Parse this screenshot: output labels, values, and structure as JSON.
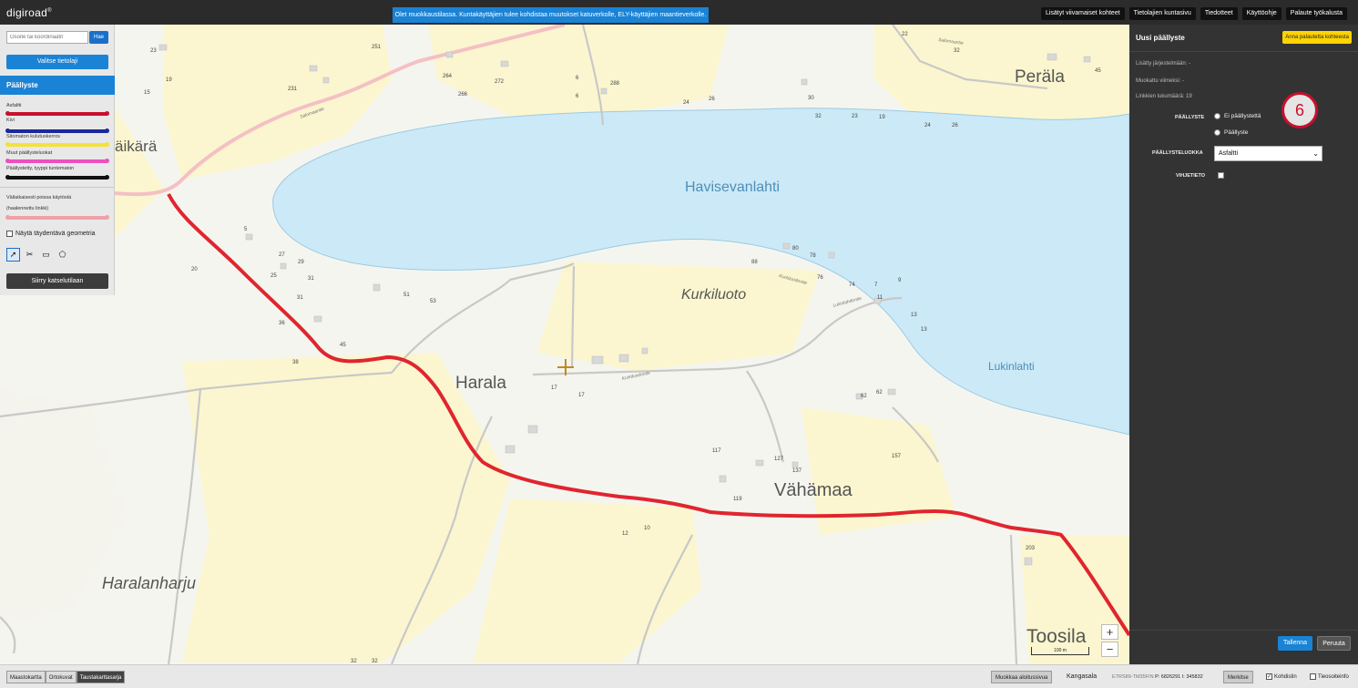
{
  "app": {
    "logo": "digiroad",
    "logo_mark": "®"
  },
  "notice": "Olet muokkaustilassa. Kuntakäyttäjien tulee kohdistaa muutokset katuverkolle, ELY-käyttäjien maantieverkolle.",
  "topnav": [
    "Lisätyt viivamaiset kohteet",
    "Tietolajien kuntasivu",
    "Tiedotteet",
    "Käyttöohje",
    "Palaute työkalusta"
  ],
  "left_panel": {
    "search_placeholder": "Osoite tai koordinaatit",
    "search_button": "Hae",
    "select_layer_button": "Valitse tietolaji",
    "layer_title": "Päällyste",
    "legend": [
      {
        "label": "Asfaltti",
        "color": "#c8102e"
      },
      {
        "label": "Kivi",
        "color": "#1a2a9a"
      },
      {
        "label": "Sitomaton kulutuskerros",
        "color": "#f3e23a"
      },
      {
        "label": "Muut päällysteluokat",
        "color": "#ee4fc0"
      },
      {
        "label": "Päällystetty, tyyppi tuntematon",
        "color": "#111111"
      }
    ],
    "temp_label_1": "Väliaikaisesti poissa käytöstä",
    "temp_label_2": "(haalennettu linkki)",
    "temp_color": "#f0a0a8",
    "show_geometry": "Näytä täydentävä geometria",
    "tools": [
      "select-tool",
      "cut-tool",
      "rectangle-tool",
      "polygon-tool"
    ],
    "view_mode_button": "Siirry katselutilaan"
  },
  "right_panel": {
    "title": "Uusi päällyste",
    "feedback_button": "Anna palautetta kohteesta",
    "added_to_system": "Lisätty järjestelmään: -",
    "modified_last": "Muokattu viimeksi: -",
    "link_count": "Linkkien lukumäärä: 19",
    "surface_label": "PÄÄLLYSTE",
    "option_none": "Ei päällystettä",
    "option_surface": "Päällyste",
    "class_label": "PÄÄLLYSTELUOKKA",
    "class_value": "Asfaltti",
    "hint_label": "VIHJETIETO",
    "marker": "6",
    "save_button": "Tallenna",
    "cancel_button": "Peruuta"
  },
  "bottom_bar": {
    "basemaps": [
      "Maastokartta",
      "Ortokuvat",
      "Taustakarttasarja"
    ],
    "active_basemap": "Taustakarttasarja",
    "start_page_button": "Muokkaa aloitussivua",
    "municipality": "Kangasala",
    "crs": "ETRS89-TM35FIN",
    "p_coord": "P: 6826291",
    "i_coord": "I: 345832",
    "mark_button": "Merkitse",
    "crosshair_label": "Kohdistin",
    "tree_label": "Tieosoiteinfo"
  },
  "map": {
    "place_names": [
      "Peräla",
      "äikärä",
      "Havisevanlahti",
      "Kurkiluoto",
      "Harala",
      "Lukinlahti",
      "Vähämaa",
      "Haralanharju",
      "Toosila"
    ],
    "scale": "100 m",
    "zoom_in": "+",
    "zoom_out": "−"
  }
}
